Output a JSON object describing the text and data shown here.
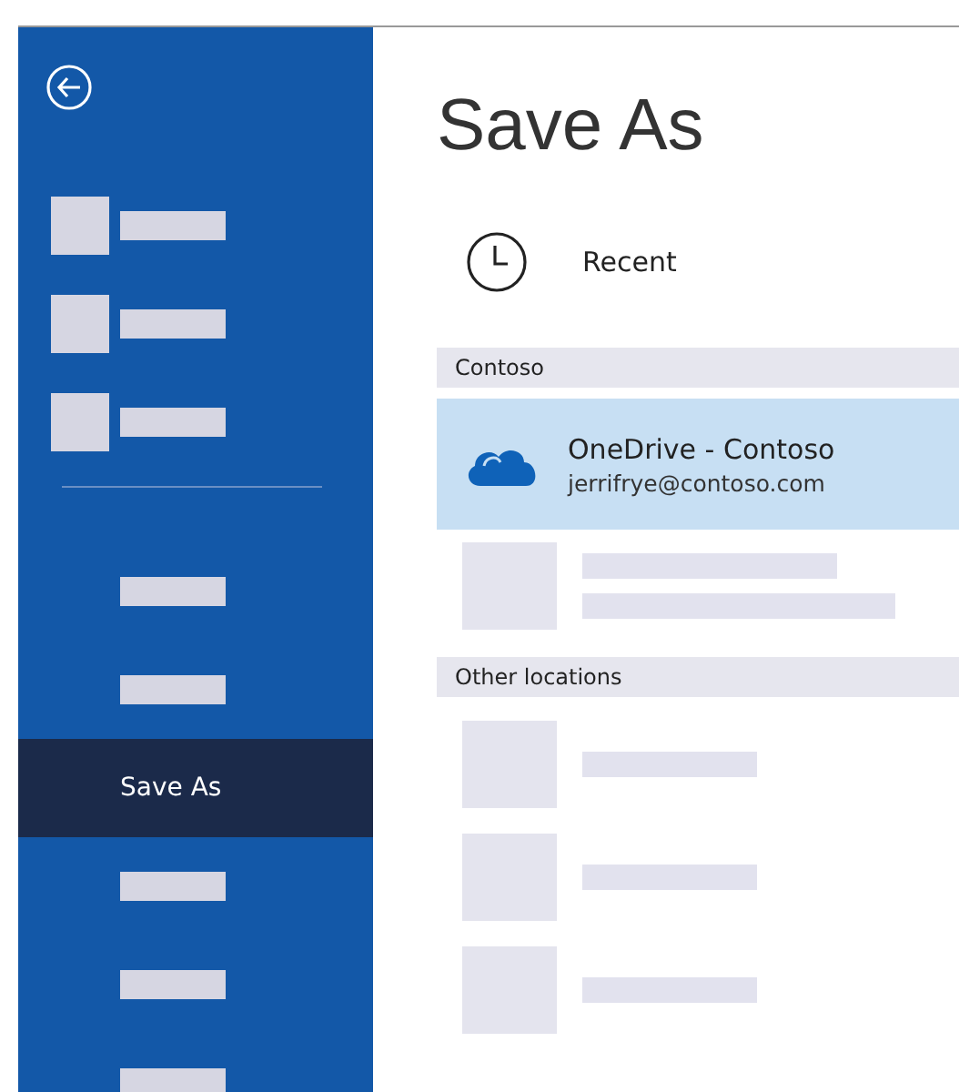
{
  "sidebar": {
    "items": [
      {
        "kind": "icon-placeholder",
        "selected": false
      },
      {
        "kind": "icon-placeholder",
        "selected": false
      },
      {
        "kind": "icon-placeholder",
        "selected": false
      },
      {
        "kind": "divider"
      },
      {
        "kind": "placeholder",
        "selected": false
      },
      {
        "kind": "placeholder",
        "selected": false
      },
      {
        "kind": "text",
        "label": "Save As",
        "selected": true
      },
      {
        "kind": "placeholder",
        "selected": false
      },
      {
        "kind": "placeholder",
        "selected": false
      },
      {
        "kind": "placeholder",
        "selected": false
      }
    ]
  },
  "title": "Save As",
  "recent": {
    "label": "Recent"
  },
  "sections": [
    {
      "heading": "Contoso",
      "locations": [
        {
          "kind": "account",
          "name": "OneDrive - Contoso",
          "email": "jerrifrye@contoso.com",
          "selected": true
        },
        {
          "kind": "placeholder",
          "selected": false
        }
      ]
    },
    {
      "heading": "Other locations",
      "locations": [
        {
          "kind": "placeholder-single",
          "selected": false
        },
        {
          "kind": "placeholder-single",
          "selected": false
        },
        {
          "kind": "placeholder-single",
          "selected": false
        }
      ]
    }
  ]
}
